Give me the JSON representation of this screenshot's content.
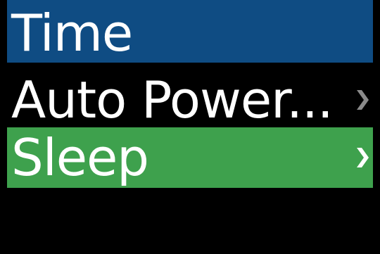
{
  "header": {
    "title": "Time",
    "background": "#0f4c83"
  },
  "menu": {
    "items": [
      {
        "label": "Auto Power...",
        "selected": false,
        "chevron_icon": "chevron-right-icon",
        "chevron_color": "#8a8a8a"
      },
      {
        "label": "Sleep",
        "selected": true,
        "background": "#3ea14d",
        "chevron_icon": "chevron-right-icon",
        "chevron_color": "#ffffff"
      }
    ]
  },
  "colors": {
    "screen_background": "#000000",
    "text": "#ffffff"
  }
}
